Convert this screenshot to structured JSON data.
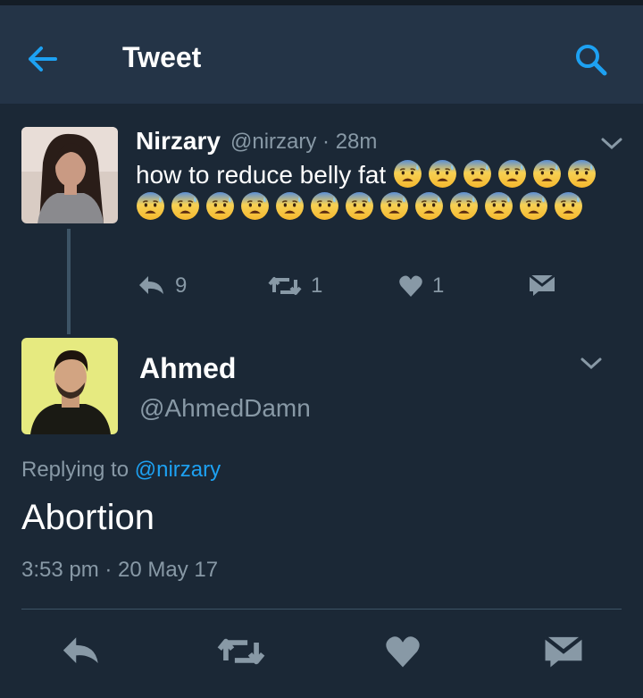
{
  "header": {
    "title": "Tweet",
    "back_icon": "back-arrow-icon",
    "search_icon": "search-icon",
    "accent_color": "#1da1f2"
  },
  "parent_tweet": {
    "name": "Nirzary",
    "handle": "@nirzary · 28m",
    "text": "how to reduce belly fat",
    "emoji_count": 19,
    "emoji_name": "anxious-face-with-sweat",
    "actions": {
      "reply_count": "9",
      "retweet_count": "1",
      "like_count": "1"
    }
  },
  "main_tweet": {
    "name": "Ahmed",
    "handle": "@AhmedDamn",
    "replying_prefix": "Replying to ",
    "replying_to": "@nirzary",
    "text": "Abortion",
    "timestamp": "3:53 pm · 20 May 17"
  },
  "colors": {
    "background": "#1b2836",
    "header_bg": "#243447",
    "secondary_text": "#8899a6",
    "thread_line": "#3d5466"
  }
}
